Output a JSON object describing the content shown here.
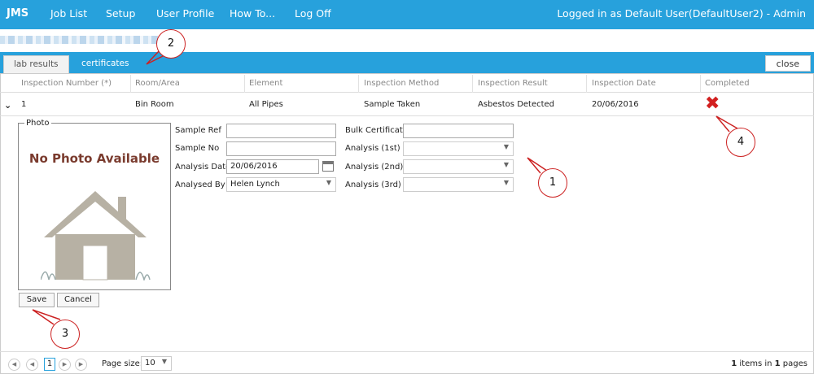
{
  "nav": {
    "brand": "JMS",
    "items": [
      "Job List",
      "Setup",
      "User Profile",
      "How To...",
      "Log Off"
    ],
    "logged_in": "Logged in as Default User(DefaultUser2) - Admin"
  },
  "tabs": {
    "lab_results": "lab results",
    "certificates": "certificates",
    "close": "close"
  },
  "grid": {
    "headers": [
      "Inspection Number (*)",
      "Room/Area",
      "Element",
      "Inspection Method",
      "Inspection Result",
      "Inspection Date",
      "Completed"
    ],
    "row": [
      "1",
      "Bin Room",
      "All Pipes",
      "Sample Taken",
      "Asbestos Detected",
      "20/06/2016"
    ],
    "completed_icon": "red-x-icon"
  },
  "form": {
    "photo_legend": "Photo",
    "no_photo": "No Photo Available",
    "sample_ref_label": "Sample Ref",
    "sample_ref_value": "",
    "sample_no_label": "Sample No",
    "sample_no_value": "",
    "analysis_date_label": "Analysis Date",
    "analysis_date_value": "20/06/2016",
    "analysed_by_label": "Analysed By",
    "analysed_by_value": "Helen Lynch",
    "bulk_certificate_label": "Bulk Certificate",
    "bulk_certificate_value": "",
    "analysis1_label": "Analysis (1st)",
    "analysis1_value": "",
    "analysis2_label": "Analysis (2nd)",
    "analysis2_value": "",
    "analysis3_label": "Analysis (3rd)",
    "analysis3_value": "",
    "save": "Save",
    "cancel": "Cancel"
  },
  "pager": {
    "current_page": "1",
    "page_size_label": "Page size:",
    "page_size": "10",
    "summary_count": "1",
    "summary_mid": " items in ",
    "summary_pages": "1",
    "summary_end": " pages"
  },
  "callouts": [
    "1",
    "2",
    "3",
    "4"
  ],
  "colors": {
    "accent": "#27a1dc",
    "callout_ring": "#cc2222",
    "completed_x": "#d21f1f"
  }
}
